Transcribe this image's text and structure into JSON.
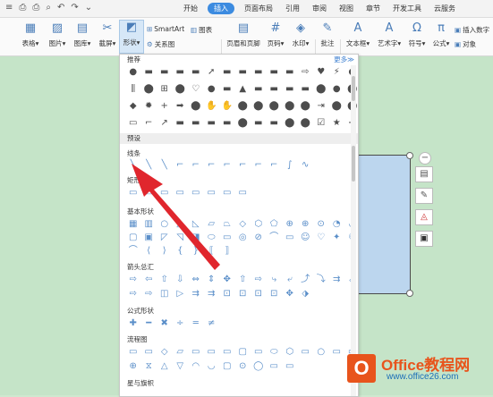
{
  "quick_access": {
    "icons": [
      "≡",
      "⎙",
      "⎙",
      "⌕",
      "↶",
      "↷",
      "⌄"
    ]
  },
  "tabs": [
    "开始",
    "插入",
    "页面布局",
    "引用",
    "审阅",
    "视图",
    "章节",
    "开发工具",
    "云服务"
  ],
  "active_tab": "插入",
  "ribbon": {
    "table": "表格",
    "picture": "图片",
    "gallery": "图库",
    "screenshot": "截屏",
    "shapes": "形状",
    "smartart": "SmartArt",
    "chart": "图表",
    "relation": "关系图",
    "header_footer": "页眉和页脚",
    "page_number": "页码",
    "watermark": "水印",
    "comment": "批注",
    "textbox": "文本框",
    "wordart": "艺术字",
    "symbol": "符号",
    "formula": "公式",
    "insert_number": "插入数字",
    "object": "对象"
  },
  "panel": {
    "recommended": "推荐",
    "more": "更多",
    "preset": "预设",
    "lines": "线条",
    "rect": "矩形",
    "basic": "基本形状",
    "arrows": "箭头总汇",
    "formula": "公式形状",
    "flowchart": "流程图",
    "stars": "星与旗帜",
    "rows": {
      "rec1": [
        "●",
        "▬",
        "▬",
        "▬",
        "▬",
        "➚",
        "▬",
        "▬",
        "▬",
        "▬",
        "▬",
        "⇨",
        "♥",
        "⚡",
        "●",
        "⚡"
      ],
      "rec2": [
        "⫼",
        "⬤",
        "⊞",
        "⬤",
        "♡",
        "●",
        "▬",
        "▲",
        "▬",
        "▬",
        "▬",
        "▬",
        "⬤",
        "●",
        "⬤",
        "●"
      ],
      "rec3": [
        "◆",
        "✹",
        "+",
        "➡",
        "⬤",
        "✋",
        "✋",
        "⬤",
        "⬤",
        "⬤",
        "⬤",
        "⬤",
        "⇥",
        "⬤",
        "⬤",
        "⬤"
      ],
      "rec4": [
        "▭",
        "⌐",
        "↗",
        "▬",
        "▬",
        "▬",
        "▬",
        "⬤",
        "▬",
        "▬",
        "⬤",
        "⬤",
        "☑",
        "★",
        "➙",
        "▬"
      ],
      "lines": [
        "╲",
        "╲",
        "╲",
        "⌐",
        "⌐",
        "⌐",
        "⌐",
        "⌐",
        "⌐",
        "⌐",
        "∫",
        "∿"
      ],
      "rect": [
        "▭",
        "▭",
        "▭",
        "▭",
        "▭",
        "▭",
        "▭",
        "▭"
      ],
      "basic1": [
        "▦",
        "▥",
        "○",
        "△",
        "◺",
        "▱",
        "⏢",
        "◇",
        "⬡",
        "⬠",
        "⊕",
        "⊕",
        "⊙",
        "◔",
        "◡",
        "◗"
      ],
      "basic2": [
        "▢",
        "▣",
        "◸",
        "◹",
        "◨",
        "⬭",
        "▭",
        "◎",
        "⊘",
        "⌒",
        "▭",
        "☺",
        "♡",
        "✦",
        "☾",
        "✸"
      ],
      "basic3": [
        "⌒",
        "⟨",
        "⟩",
        "{",
        "}",
        "⟦",
        "⟧"
      ],
      "arrows1": [
        "⇨",
        "⇦",
        "⇧",
        "⇩",
        "⇔",
        "⇕",
        "✥",
        "⇧",
        "⇨",
        "⤷",
        "⤶",
        "⤴",
        "⤵",
        "⇉",
        "⬀",
        "⬂"
      ],
      "arrows2": [
        "⇨",
        "⇨",
        "◫",
        "▷",
        "⇉",
        "⇉",
        "⊡",
        "⊡",
        "⊡",
        "⊡",
        "✥",
        "⬗"
      ],
      "formula": [
        "✚",
        "━",
        "✖",
        "÷",
        "═",
        "≠"
      ],
      "flow1": [
        "▭",
        "▭",
        "◇",
        "▱",
        "▭",
        "▭",
        "▭",
        "▢",
        "▭",
        "⬭",
        "⬡",
        "▭",
        "○",
        "▭",
        "▭",
        "⊗"
      ],
      "flow2": [
        "⊕",
        "⧖",
        "△",
        "▽",
        "◠",
        "◡",
        "▢",
        "⊙",
        "◯",
        "▭",
        "▭"
      ]
    }
  },
  "logo": {
    "mark": "O",
    "title": "Office教程网",
    "url": "www.office26.com"
  },
  "colors": {
    "accent": "#3c8be0",
    "doc_bg": "#c5e4c8",
    "shape_fill": "#bcd6ee",
    "arrow": "#e0262d",
    "logo": "#e8541c"
  }
}
